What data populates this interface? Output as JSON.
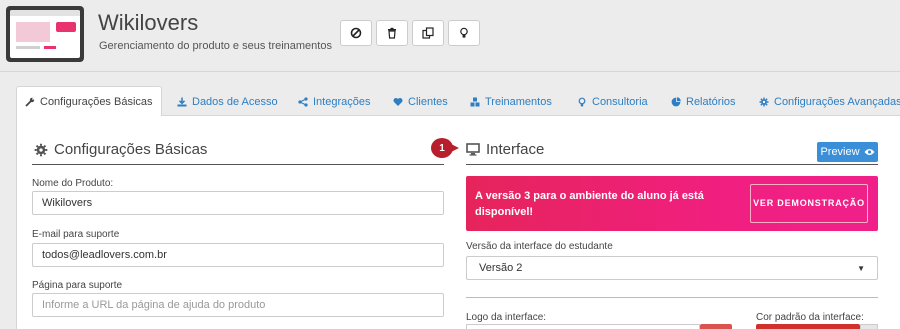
{
  "header": {
    "title": "Wikilovers",
    "subtitle": "Gerenciamento do produto e seus treinamentos",
    "actions": [
      {
        "icon": "ban-icon"
      },
      {
        "icon": "trash-icon"
      },
      {
        "icon": "copy-icon"
      },
      {
        "icon": "lightbulb-icon"
      }
    ]
  },
  "tabs": [
    {
      "label": "Configurações Básicas",
      "icon": "wrench-icon",
      "active": true
    },
    {
      "label": "Dados de Acesso",
      "icon": "download-icon"
    },
    {
      "label": "Integrações",
      "icon": "share-icon"
    },
    {
      "label": "Clientes",
      "icon": "heart-icon"
    },
    {
      "label": "Treinamentos",
      "icon": "cubes-icon"
    },
    {
      "label": "Consultoria",
      "icon": "lightbulb-icon"
    },
    {
      "label": "Relatórios",
      "icon": "pie-chart-icon"
    },
    {
      "label": "Configurações Avançadas",
      "icon": "gear-icon"
    }
  ],
  "basic": {
    "heading": "Configurações Básicas",
    "product_name_label": "Nome do Produto:",
    "product_name_value": "Wikilovers",
    "support_email_label": "E-mail para suporte",
    "support_email_value": "todos@leadlovers.com.br",
    "support_page_label": "Página para suporte",
    "support_page_placeholder": "Informe a URL da página de ajuda do produto"
  },
  "interface": {
    "heading": "Interface",
    "callout_number": "1",
    "preview_label": "Preview",
    "promo_text": "A versão 3 para o ambiente do aluno já está disponível!",
    "promo_button": "VER DEMONSTRAÇÃO",
    "version_label": "Versão da interface do estudante",
    "version_value": "Versão 2",
    "logo_label": "Logo da interface:",
    "color_label": "Cor padrão da interface:"
  },
  "colors": {
    "accent": "#2e7ec2",
    "promo": "#f01f7f",
    "badge": "#b81f2c",
    "preview": "#3a8fd8"
  }
}
